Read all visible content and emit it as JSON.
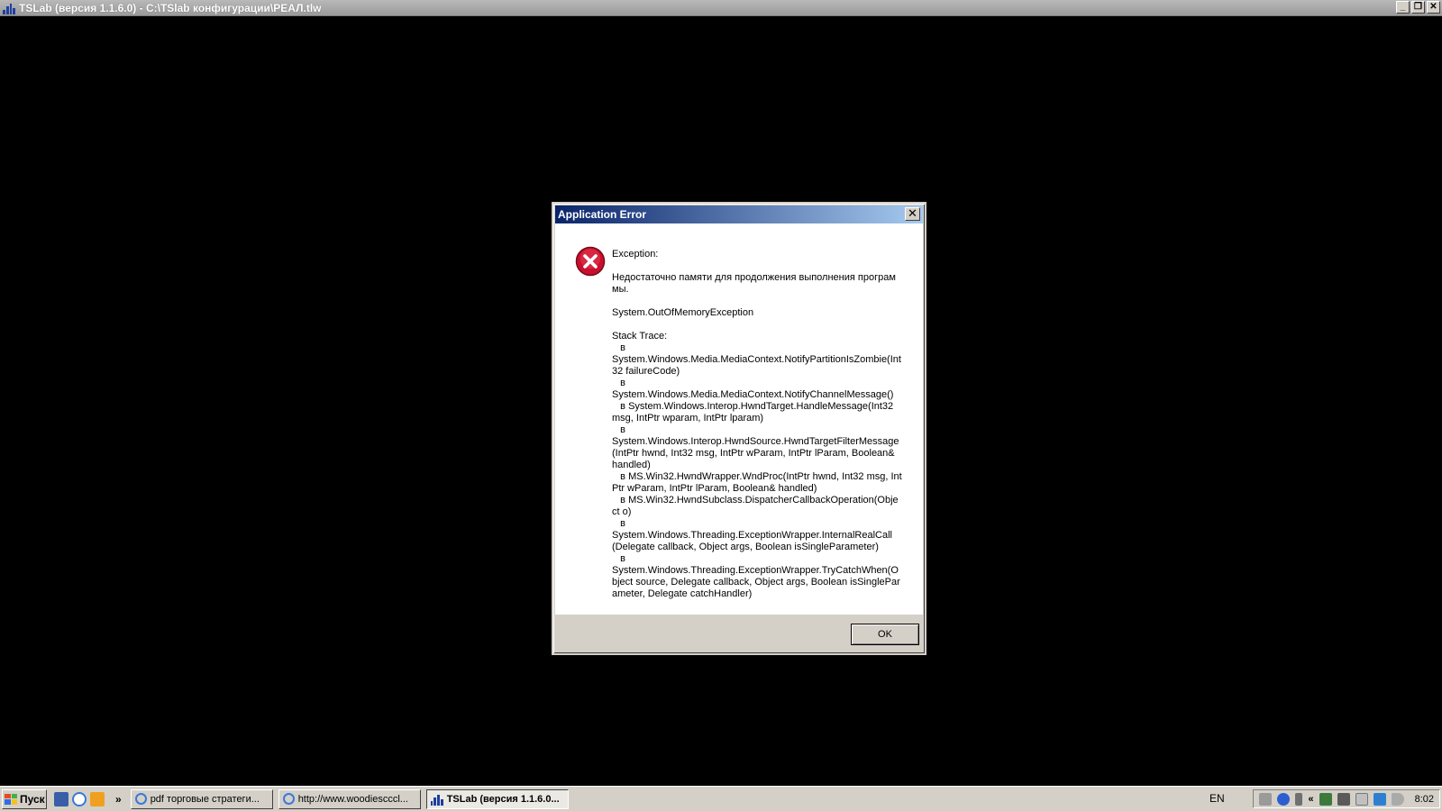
{
  "app": {
    "title": "TSLab (версия 1.1.6.0) - C:\\TSlab конфигурации\\РЕАЛ.tlw",
    "controls": [
      "_",
      "❐",
      "✕"
    ]
  },
  "dialog": {
    "title": "Application Error",
    "close": "✕",
    "message": "Exception:\n\nНедостаточно памяти для продолжения выполнения программы.\n\nSystem.OutOfMemoryException\n\nStack Trace:\n   в\nSystem.Windows.Media.MediaContext.NotifyPartitionIsZombie(Int32 failureCode)\n   в\nSystem.Windows.Media.MediaContext.NotifyChannelMessage()\n   в System.Windows.Interop.HwndTarget.HandleMessage(Int32 msg, IntPtr wparam, IntPtr lparam)\n   в\nSystem.Windows.Interop.HwndSource.HwndTargetFilterMessage(IntPtr hwnd, Int32 msg, IntPtr wParam, IntPtr lParam, Boolean& handled)\n   в MS.Win32.HwndWrapper.WndProc(IntPtr hwnd, Int32 msg, IntPtr wParam, IntPtr lParam, Boolean& handled)\n   в MS.Win32.HwndSubclass.DispatcherCallbackOperation(Object o)\n   в\nSystem.Windows.Threading.ExceptionWrapper.InternalRealCall(Delegate callback, Object args, Boolean isSingleParameter)\n   в\nSystem.Windows.Threading.ExceptionWrapper.TryCatchWhen(Object source, Delegate callback, Object args, Boolean isSingleParameter, Delegate catchHandler)",
    "ok_label": "OK"
  },
  "taskbar": {
    "start_label": "Пуск",
    "more": "»",
    "tasks": [
      {
        "label": "pdf торговые стратеги..."
      },
      {
        "label": "http://www.woodiescccl..."
      },
      {
        "label": "TSLab (версия 1.1.6.0..."
      }
    ],
    "lang": "EN",
    "tray_chevron": "«",
    "clock": "8:02"
  },
  "colors": {
    "dialog_title_start": "#0a246a",
    "dialog_title_end": "#a6caf0",
    "error_red": "#c8102e"
  }
}
